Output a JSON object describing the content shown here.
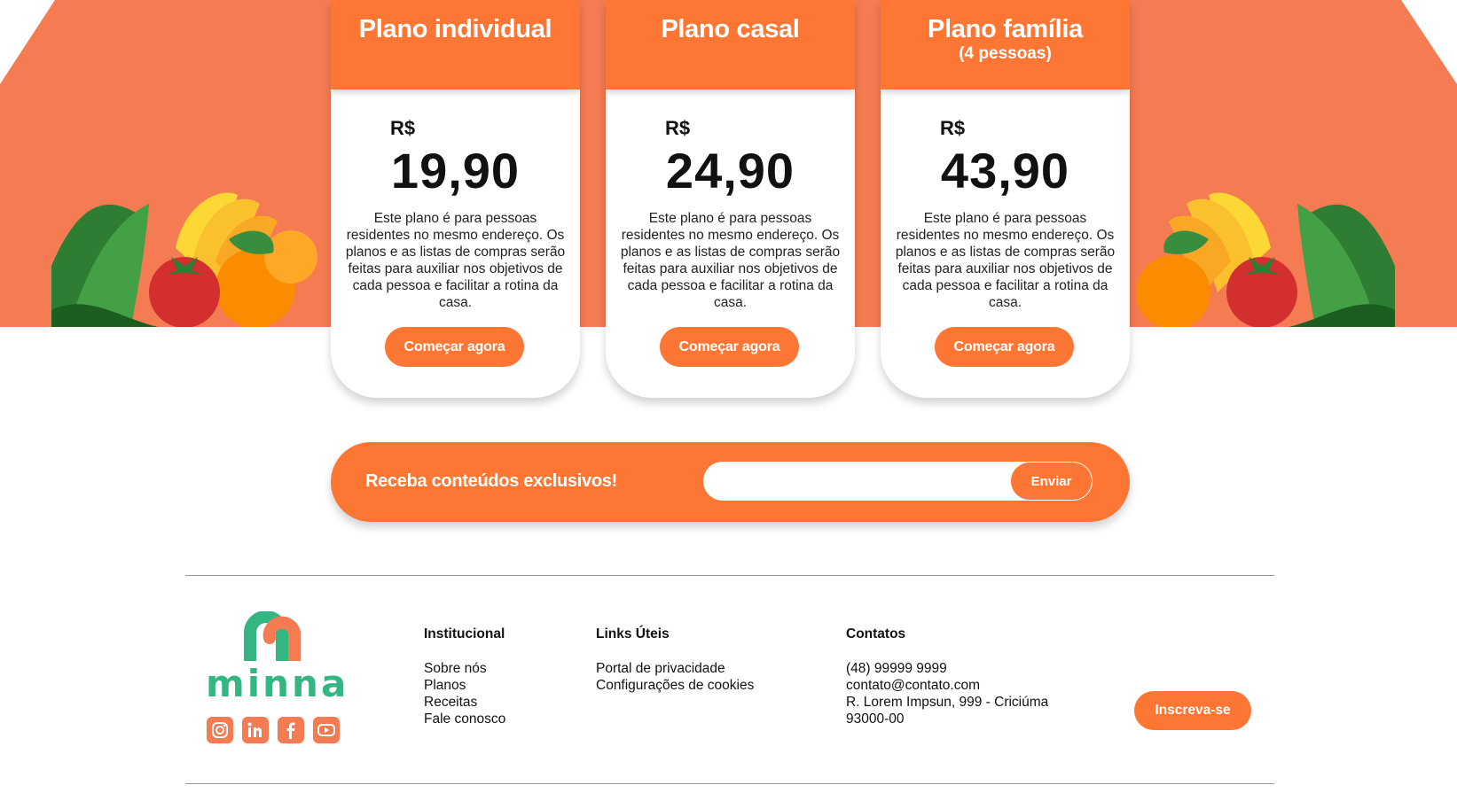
{
  "plans": [
    {
      "title": "Plano individual",
      "subtitle": "",
      "currency": "R$",
      "price": "19,90",
      "description": "Este plano é para pessoas residentes no mesmo endereço. Os planos e as listas de compras serão feitas para auxiliar nos objetivos de cada pessoa e facilitar a rotina da casa.",
      "cta": "Começar agora"
    },
    {
      "title": "Plano casal",
      "subtitle": "",
      "currency": "R$",
      "price": "24,90",
      "description": "Este plano é para pessoas residentes no mesmo endereço. Os planos e as listas de compras serão feitas para auxiliar nos objetivos de cada pessoa e facilitar a rotina da casa.",
      "cta": "Começar agora"
    },
    {
      "title": "Plano família",
      "subtitle": "(4 pessoas)",
      "currency": "R$",
      "price": "43,90",
      "description": "Este plano é para pessoas residentes no mesmo endereço. Os planos e as listas de compras serão feitas para auxiliar nos objetivos de cada pessoa e facilitar a rotina da casa.",
      "cta": "Começar agora"
    }
  ],
  "newsletter": {
    "label": "Receba conteúdos exclusivos!",
    "input_value": "",
    "submit_label": "Enviar"
  },
  "footer": {
    "brand": "minna",
    "socials": [
      "instagram-icon",
      "linkedin-icon",
      "facebook-icon",
      "youtube-icon"
    ],
    "institucional": {
      "heading": "Institucional",
      "links": [
        "Sobre nós",
        "Planos",
        "Receitas",
        "Fale conosco"
      ]
    },
    "links_uteis": {
      "heading": "Links Úteis",
      "links": [
        "Portal de privacidade",
        "Configurações de cookies"
      ]
    },
    "contatos": {
      "heading": "Contatos",
      "phone": "(48) 99999 9999",
      "email": "contato@contato.com",
      "address": "R. Lorem Impsun, 999 - Criciúma",
      "zip": "93000-00"
    },
    "subscribe_label": "Inscreva-se"
  },
  "colors": {
    "hero_band": "#f57b52",
    "accent": "#fe7633",
    "brand_green": "#34b682"
  }
}
